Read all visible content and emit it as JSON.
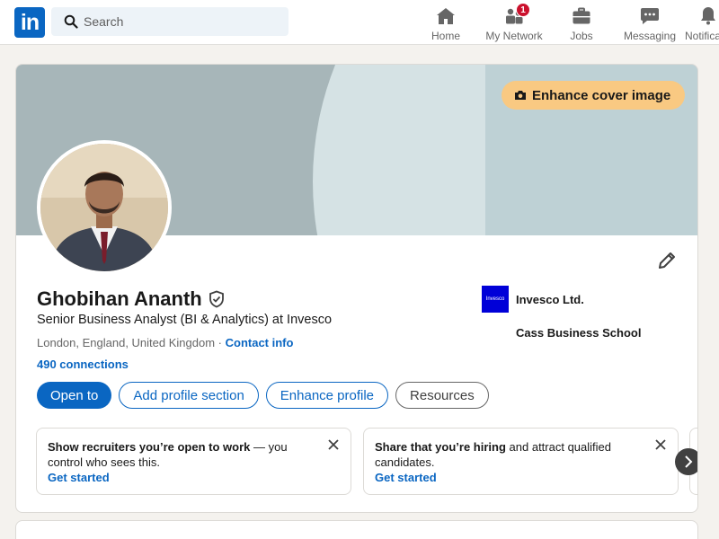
{
  "nav": {
    "logo": "in",
    "search_placeholder": "Search",
    "items": [
      {
        "label": "Home",
        "icon": "home-icon"
      },
      {
        "label": "My Network",
        "icon": "people-icon",
        "badge": "1"
      },
      {
        "label": "Jobs",
        "icon": "briefcase-icon"
      },
      {
        "label": "Messaging",
        "icon": "chat-icon"
      },
      {
        "label": "Notifications",
        "icon": "bell-icon"
      }
    ]
  },
  "profile": {
    "enhance_cover_label": "Enhance cover image",
    "name": "Ghobihan Ananth",
    "headline": "Senior Business Analyst (BI & Analytics) at Invesco",
    "location": "London, England, United Kingdom",
    "location_sep": " · ",
    "contact_label": "Contact info",
    "connections": "490 connections",
    "company": {
      "logo_text": "Invesco",
      "name": "Invesco Ltd."
    },
    "school": "Cass Business School",
    "buttons": {
      "open_to": "Open to",
      "add_section": "Add profile section",
      "enhance_profile": "Enhance profile",
      "resources": "Resources"
    }
  },
  "promos": [
    {
      "bold": "Show recruiters you’re open to work",
      "text": " — you control who sees this.",
      "cta": "Get started"
    },
    {
      "bold": "Share that you’re hiring",
      "text": " and attract qualified candidates.",
      "cta": "Get started"
    }
  ],
  "colors": {
    "brand": "#0a66c2",
    "cover_button": "#f9c982",
    "badge": "#cb112d",
    "company_logo": "#0000d8"
  }
}
